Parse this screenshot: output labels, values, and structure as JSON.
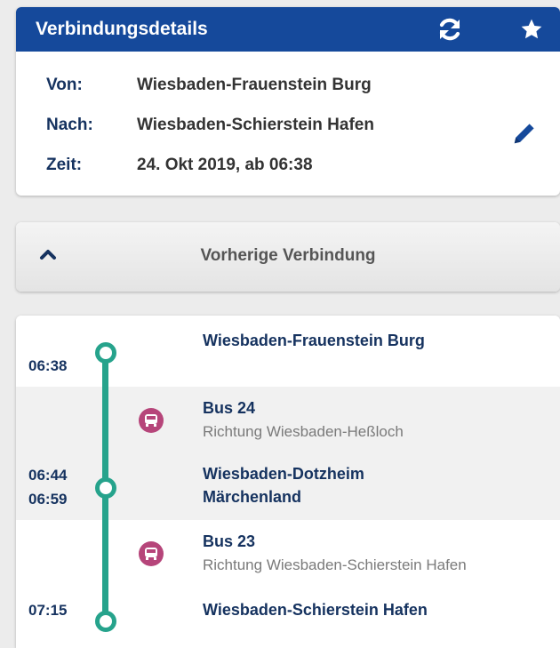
{
  "header": {
    "title": "Verbindungsdetails",
    "refresh_icon": "refresh-icon",
    "favorite_icon": "star-icon",
    "color": "#15499b"
  },
  "details": {
    "from_label": "Von:",
    "from_value": "Wiesbaden-Frauenstein Burg",
    "to_label": "Nach:",
    "to_value": "Wiesbaden-Schierstein Hafen",
    "time_label": "Zeit:",
    "time_value": "24. Okt 2019, ab 06:38",
    "edit_icon": "pencil-icon"
  },
  "previous": {
    "label": "Vorherige Verbindung",
    "icon": "chevron-up-icon"
  },
  "timeline": {
    "line_color": "#26a38c",
    "bus_color": "#b6457a",
    "stops": [
      {
        "time": "06:38",
        "name": "Wiesbaden-Frauenstein Burg"
      },
      {
        "time_arr": "06:44",
        "time_dep": "06:59",
        "name_line1": "Wiesbaden-Dotzheim",
        "name_line2": "Märchenland"
      },
      {
        "time": "07:15",
        "name": "Wiesbaden-Schierstein Hafen"
      }
    ],
    "legs": [
      {
        "line": "Bus 24",
        "direction": "Richtung Wiesbaden-Heßloch",
        "icon": "bus-icon"
      },
      {
        "line": "Bus 23",
        "direction": "Richtung Wiesbaden-Schierstein Hafen",
        "icon": "bus-icon"
      }
    ]
  }
}
